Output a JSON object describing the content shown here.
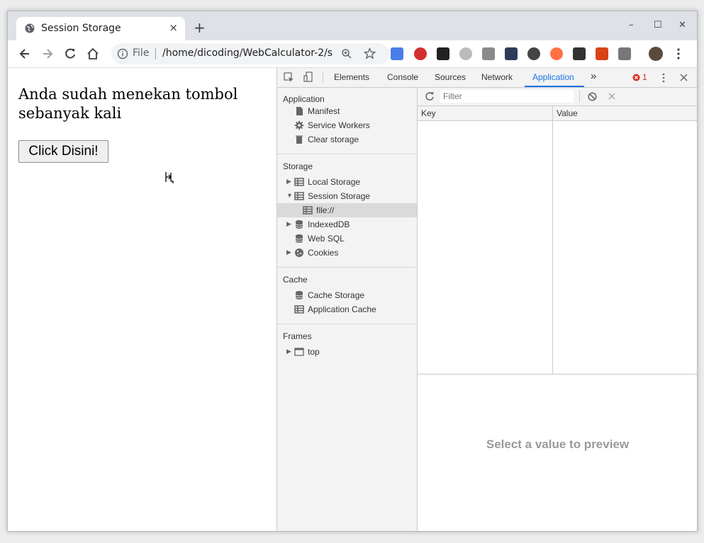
{
  "browser": {
    "tab_title": "Session Storage",
    "tab_close": "×",
    "new_tab": "+",
    "win_minimize": "–",
    "win_maximize": "☐",
    "win_close": "✕",
    "omnibox_scheme": "File",
    "omnibox_url": "/home/dicoding/WebCalculator-2/s..."
  },
  "page": {
    "message": "Anda sudah menekan tombol sebanyak kali",
    "button_label": "Click Disini!"
  },
  "devtools": {
    "tabs": [
      "Elements",
      "Console",
      "Sources",
      "Network",
      "Application"
    ],
    "more_tabs": "»",
    "error_count": "1",
    "sidebar": {
      "application_title": "Application",
      "application_items": [
        "Manifest",
        "Service Workers",
        "Clear storage"
      ],
      "storage_title": "Storage",
      "storage_items": [
        "Local Storage",
        "Session Storage",
        "file://",
        "IndexedDB",
        "Web SQL",
        "Cookies"
      ],
      "cache_title": "Cache",
      "cache_items": [
        "Cache Storage",
        "Application Cache"
      ],
      "frames_title": "Frames",
      "frames_items": [
        "top"
      ]
    },
    "storage": {
      "filter_placeholder": "Filter",
      "col_key": "Key",
      "col_value": "Value",
      "preview_text": "Select a value to preview"
    }
  }
}
